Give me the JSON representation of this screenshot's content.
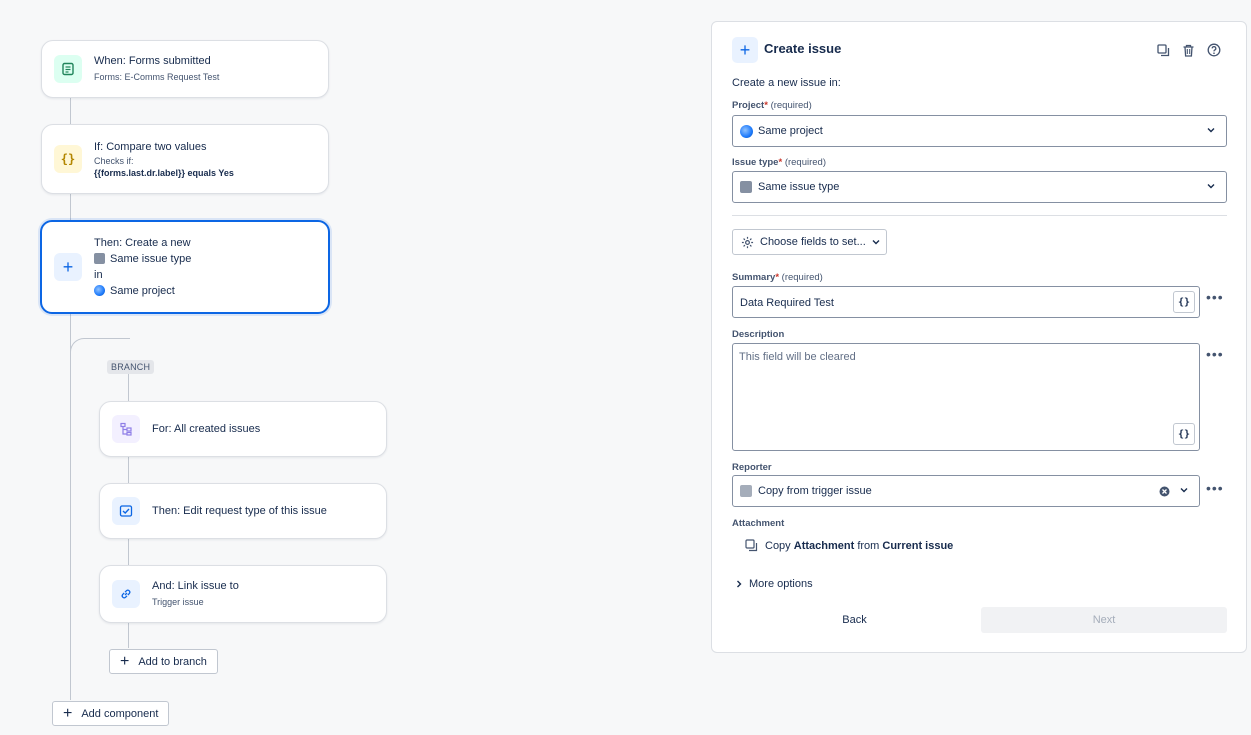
{
  "flow": {
    "trigger": {
      "title": "When: Forms submitted",
      "subtitle": "Forms: E-Comms Request Test"
    },
    "condition": {
      "title": "If: Compare two values",
      "checks_prefix": "Checks if:",
      "expression": "{{forms.last.dr.label}} equals Yes",
      "icon_glyph": "{}"
    },
    "action": {
      "line1": "Then: Create a new",
      "issue_type": "Same issue type",
      "in_word": "in",
      "project": "Same project"
    },
    "branch_label": "BRANCH",
    "branch": {
      "for": {
        "title": "For: All created issues"
      },
      "edit": {
        "title": "Then: Edit request type of this issue"
      },
      "link": {
        "title": "And: Link issue to",
        "subtitle": "Trigger issue"
      },
      "add_to_branch": "Add to branch"
    },
    "add_component": "Add component"
  },
  "panel": {
    "title": "Create issue",
    "intro": "Create a new issue in:",
    "project": {
      "label": "Project",
      "required": "(required)",
      "value": "Same project"
    },
    "issue_type": {
      "label": "Issue type",
      "required": "(required)",
      "value": "Same issue type"
    },
    "choose_fields": "Choose fields to set...",
    "summary": {
      "label": "Summary",
      "required": "(required)",
      "value": "Data Required Test"
    },
    "description": {
      "label": "Description",
      "placeholder": "This field will be cleared"
    },
    "reporter": {
      "label": "Reporter",
      "value": "Copy from trigger issue"
    },
    "attachment": {
      "label": "Attachment",
      "copy": "Copy",
      "field": "Attachment",
      "from": "from",
      "source": "Current issue"
    },
    "more_options": "More options",
    "back": "Back",
    "next": "Next",
    "smart_value_glyph": "{}"
  },
  "colors": {
    "accent": "#0c66e4",
    "border": "#dcdfe4",
    "text": "#172b4d"
  }
}
